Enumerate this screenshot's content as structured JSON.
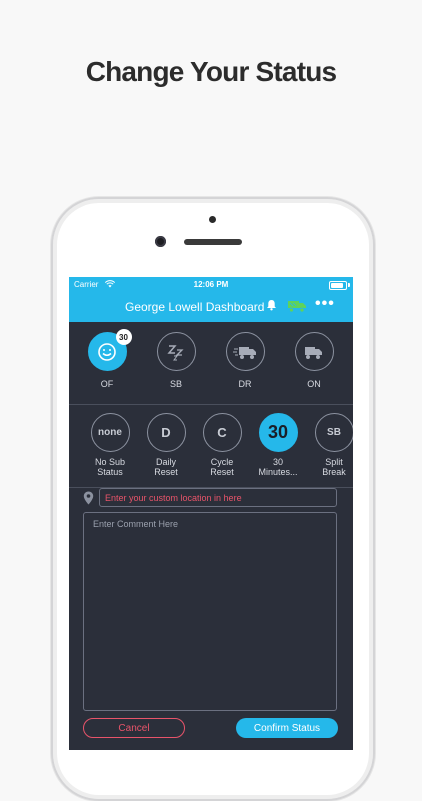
{
  "headline": "Change Your Status",
  "status_bar": {
    "carrier": "Carrier",
    "time": "12:06 PM"
  },
  "header": {
    "title": "George Lowell Dashboard"
  },
  "duty_statuses": [
    {
      "label": "OF",
      "badge": "30",
      "icon": "smiley-icon",
      "active": true
    },
    {
      "label": "SB",
      "icon": "sleep-zzz-icon",
      "active": false
    },
    {
      "label": "DR",
      "icon": "driving-truck-icon",
      "active": false
    },
    {
      "label": "ON",
      "icon": "truck-icon",
      "active": false
    }
  ],
  "sub_statuses": [
    {
      "circle": "none",
      "label_line1": "No Sub",
      "label_line2": "Status"
    },
    {
      "circle": "D",
      "label_line1": "Daily",
      "label_line2": "Reset"
    },
    {
      "circle": "C",
      "label_line1": "Cycle",
      "label_line2": "Reset"
    },
    {
      "circle": "30",
      "label_line1": "30",
      "label_line2": "Minutes...",
      "active": true
    },
    {
      "circle": "SB",
      "label_line1": "Split",
      "label_line2": "Break"
    }
  ],
  "location": {
    "placeholder": "Enter your custom location in here"
  },
  "comment": {
    "placeholder": "Enter Comment Here"
  },
  "buttons": {
    "cancel": "Cancel",
    "confirm": "Confirm Status"
  },
  "colors": {
    "accent": "#25b8ea",
    "danger": "#e8546a",
    "background": "#2b2f3a",
    "truck_green": "#5fd35a"
  }
}
